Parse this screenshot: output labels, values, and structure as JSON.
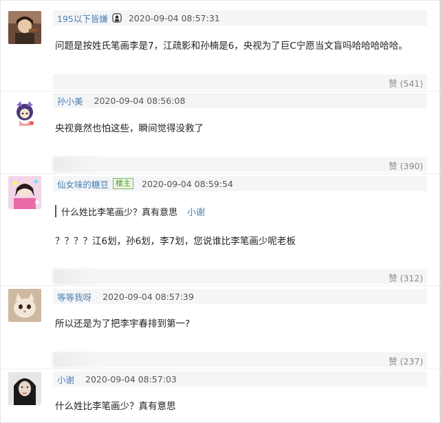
{
  "comments": [
    {
      "username": "195以下皆嫌",
      "timestamp": "2020-09-04 08:57:31",
      "text": "问题是按姓氏笔画李是7，江疏影和孙楠是6，央视为了巨C宁愿当文盲吗哈哈哈哈哈。",
      "likes": "赞 (541)"
    },
    {
      "username": "孙小美",
      "timestamp": "2020-09-04 08:56:08",
      "text": "央视竟然也怕这些，瞬间觉得没救了",
      "likes": "赞 (390)"
    },
    {
      "username": "仙女味的糖豆",
      "badge": "楼主",
      "timestamp": "2020-09-04 08:59:54",
      "quote_text": "什么姓比李笔画少？真有意思",
      "quote_user": "小谢",
      "text": "？？？？江6划，孙6划，李7划，您说谁比李笔画少呢老板",
      "likes": "赞 (312)"
    },
    {
      "username": "等等我呀",
      "timestamp": "2020-09-04 08:57:39",
      "text": "所以还是为了把李宇春排到第一?",
      "likes": "赞 (237)"
    },
    {
      "username": "小谢",
      "timestamp": "2020-09-04 08:57:03",
      "text": "什么姓比李笔画少？真有意思"
    }
  ],
  "colors": {
    "username": "#4a7fb5",
    "bar_bg": "#f4f5f6",
    "likes": "#8a8a8a",
    "host_badge": "#4d9a2c"
  }
}
